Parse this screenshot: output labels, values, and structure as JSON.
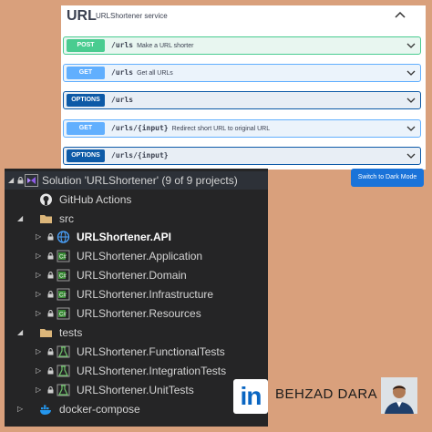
{
  "swagger": {
    "title": "URL",
    "subtitle": "URLShortener service",
    "operations": [
      {
        "method": "POST",
        "path": "/urls",
        "desc": "Make a URL shorter"
      },
      {
        "method": "GET",
        "path": "/urls",
        "desc": "Get all URLs"
      },
      {
        "method": "OPTIONS",
        "path": "/urls",
        "desc": ""
      },
      {
        "method": "GET",
        "path": "/urls/{input}",
        "desc": "Redirect short URL to original URL"
      },
      {
        "method": "OPTIONS",
        "path": "/urls/{input}",
        "desc": ""
      }
    ],
    "dark_mode_label": "Switch to Dark Mode"
  },
  "explorer": {
    "solution": "Solution 'URLShortener' (9 of 9 projects)",
    "github_actions": "GitHub Actions",
    "src_folder": "src",
    "src_projects": [
      "URLShortener.API",
      "URLShortener.Application",
      "URLShortener.Domain",
      "URLShortener.Infrastructure",
      "URLShortener.Resources"
    ],
    "tests_folder": "tests",
    "test_projects": [
      "URLShortener.FunctionalTests",
      "URLShortener.IntegrationTests",
      "URLShortener.UnitTests"
    ],
    "docker": "docker-compose"
  },
  "branding": {
    "linkedin_mark": "in",
    "author": "BEHZAD DARA"
  },
  "colors": {
    "background": "#d9a07c",
    "post": "#49cc90",
    "get": "#61affe",
    "options": "#0d5aa7",
    "explorer_bg": "#252526",
    "dark_button": "#1a73d9",
    "linkedin": "#0a66c2"
  }
}
